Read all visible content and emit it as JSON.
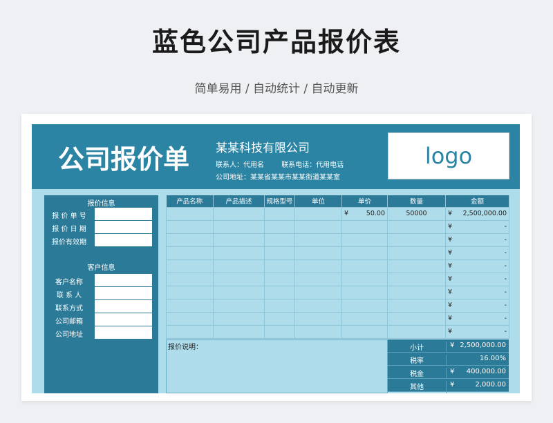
{
  "header": {
    "title": "蓝色公司产品报价表",
    "subtitle": "简单易用 / 自动统计 / 自动更新"
  },
  "banner": {
    "title": "公司报价单",
    "company": "某某科技有限公司",
    "contact_person": "联系人：代用名",
    "contact_phone": "联系电话：代用电话",
    "address": "公司地址：某某省某某市某某街道某某室",
    "logo": "logo"
  },
  "quote_info": {
    "heading": "报价信息",
    "fields": [
      "报 价 单 号",
      "报 价 日 期",
      "报价有效期"
    ]
  },
  "customer_info": {
    "heading": "客户信息",
    "fields": [
      "客户名称",
      "联 系 人",
      "联系方式",
      "公司邮箱",
      "公司地址"
    ]
  },
  "table": {
    "columns": [
      "产品名称",
      "产品描述",
      "规格型号",
      "单位",
      "单价",
      "数量",
      "金额"
    ],
    "rows": [
      {
        "name": "",
        "desc": "",
        "spec": "",
        "unit": "",
        "price_cur": "¥",
        "price": "50.00",
        "qty": "50000",
        "amt_cur": "¥",
        "amount": "2,500,000.00"
      },
      {
        "name": "",
        "desc": "",
        "spec": "",
        "unit": "",
        "price_cur": "",
        "price": "",
        "qty": "",
        "amt_cur": "¥",
        "amount": "-"
      },
      {
        "name": "",
        "desc": "",
        "spec": "",
        "unit": "",
        "price_cur": "",
        "price": "",
        "qty": "",
        "amt_cur": "¥",
        "amount": "-"
      },
      {
        "name": "",
        "desc": "",
        "spec": "",
        "unit": "",
        "price_cur": "",
        "price": "",
        "qty": "",
        "amt_cur": "¥",
        "amount": "-"
      },
      {
        "name": "",
        "desc": "",
        "spec": "",
        "unit": "",
        "price_cur": "",
        "price": "",
        "qty": "",
        "amt_cur": "¥",
        "amount": "-"
      },
      {
        "name": "",
        "desc": "",
        "spec": "",
        "unit": "",
        "price_cur": "",
        "price": "",
        "qty": "",
        "amt_cur": "¥",
        "amount": "-"
      },
      {
        "name": "",
        "desc": "",
        "spec": "",
        "unit": "",
        "price_cur": "",
        "price": "",
        "qty": "",
        "amt_cur": "¥",
        "amount": "-"
      },
      {
        "name": "",
        "desc": "",
        "spec": "",
        "unit": "",
        "price_cur": "",
        "price": "",
        "qty": "",
        "amt_cur": "¥",
        "amount": "-"
      },
      {
        "name": "",
        "desc": "",
        "spec": "",
        "unit": "",
        "price_cur": "",
        "price": "",
        "qty": "",
        "amt_cur": "¥",
        "amount": "-"
      },
      {
        "name": "",
        "desc": "",
        "spec": "",
        "unit": "",
        "price_cur": "",
        "price": "",
        "qty": "",
        "amt_cur": "¥",
        "amount": "-"
      }
    ]
  },
  "notes": {
    "label": "报价说明："
  },
  "summary": [
    {
      "label": "小计",
      "cur": "¥",
      "value": "2,500,000.00"
    },
    {
      "label": "税率",
      "cur": "",
      "value": "16.00%"
    },
    {
      "label": "税金",
      "cur": "¥",
      "value": "400,000.00"
    },
    {
      "label": "其他",
      "cur": "¥",
      "value": "2,000.00"
    }
  ],
  "colors": {
    "primary": "#2b7a98",
    "banner": "#2b84a3",
    "sheet_bg": "#aedceb"
  }
}
